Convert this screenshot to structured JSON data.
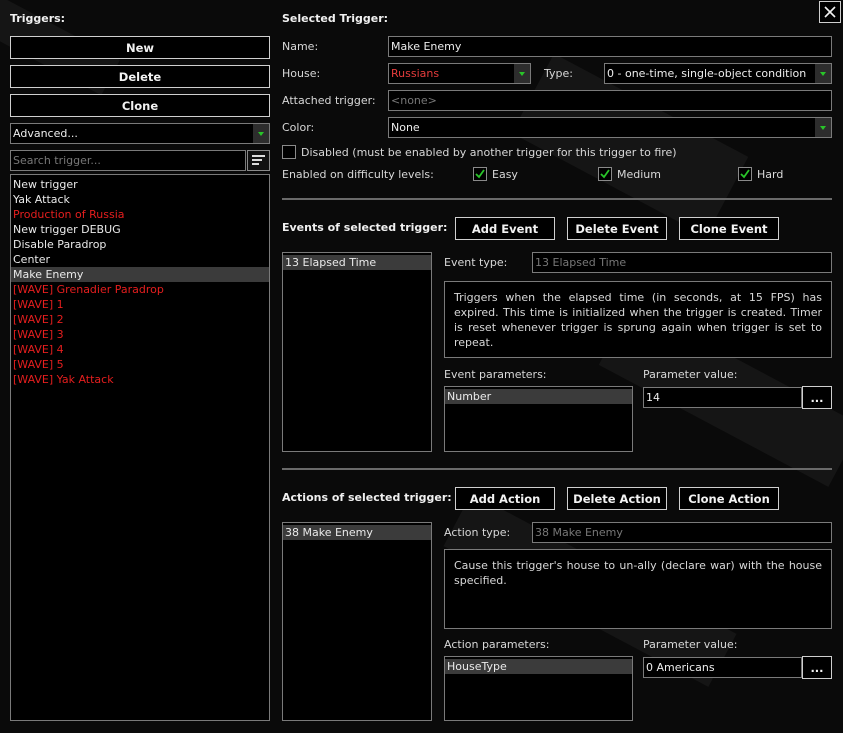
{
  "colors": {
    "background": "#0a0a0a",
    "accent_check": "#29c429",
    "house_red": "#e53c3c",
    "list_red": "#e51e1e"
  },
  "close_icon": "close-icon",
  "left": {
    "title": "Triggers:",
    "new_label": "New",
    "delete_label": "Delete",
    "clone_label": "Clone",
    "filter_selected": "Advanced...",
    "search_placeholder": "Search trigger...",
    "list_icon": "sort-lines-icon",
    "items": [
      {
        "label": "New trigger",
        "color": "white"
      },
      {
        "label": "Yak Attack",
        "color": "white"
      },
      {
        "label": "Production of Russia",
        "color": "red"
      },
      {
        "label": "New trigger DEBUG",
        "color": "white"
      },
      {
        "label": "Disable Paradrop",
        "color": "white"
      },
      {
        "label": "Center",
        "color": "white"
      },
      {
        "label": "Make Enemy",
        "color": "white",
        "selected": true
      },
      {
        "label": "[WAVE] Grenadier Paradrop",
        "color": "red"
      },
      {
        "label": "[WAVE] 1",
        "color": "red"
      },
      {
        "label": "[WAVE] 2",
        "color": "red"
      },
      {
        "label": "[WAVE] 3",
        "color": "red"
      },
      {
        "label": "[WAVE] 4",
        "color": "red"
      },
      {
        "label": "[WAVE] 5",
        "color": "red"
      },
      {
        "label": "[WAVE] Yak Attack",
        "color": "red"
      }
    ]
  },
  "trigger": {
    "title": "Selected Trigger:",
    "name_label": "Name:",
    "name_value": "Make Enemy",
    "house_label": "House:",
    "house_value": "Russians",
    "type_label": "Type:",
    "type_value": "0 - one-time, single-object condition",
    "attached_label": "Attached trigger:",
    "attached_value": "<none>",
    "color_label": "Color:",
    "color_value": "None",
    "disabled_label": "Disabled (must be enabled by another trigger for this trigger to fire)",
    "disabled_checked": false,
    "difficulty_label": "Enabled on difficulty levels:",
    "easy_label": "Easy",
    "easy_checked": true,
    "medium_label": "Medium",
    "medium_checked": true,
    "hard_label": "Hard",
    "hard_checked": true
  },
  "events": {
    "title": "Events of selected trigger:",
    "add_label": "Add Event",
    "delete_label": "Delete Event",
    "clone_label": "Clone Event",
    "list": [
      "13 Elapsed Time"
    ],
    "type_label": "Event type:",
    "type_value": "13 Elapsed Time",
    "description": "Triggers when the elapsed time (in seconds, at 15 FPS) has expired. This time is initialized when the trigger is created. Timer is reset whenever trigger is sprung again when trigger is set to repeat.",
    "params_label": "Event parameters:",
    "params": [
      "Number"
    ],
    "value_label": "Parameter value:",
    "value": "14",
    "browse_label": "..."
  },
  "actions": {
    "title": "Actions of selected trigger:",
    "add_label": "Add Action",
    "delete_label": "Delete Action",
    "clone_label": "Clone Action",
    "list": [
      "38 Make Enemy"
    ],
    "type_label": "Action type:",
    "type_value": "38 Make Enemy",
    "description": "Cause this trigger's house to un-ally (declare war) with the house specified.",
    "params_label": "Action parameters:",
    "params": [
      "HouseType"
    ],
    "value_label": "Parameter value:",
    "value": "0 Americans",
    "browse_label": "..."
  }
}
